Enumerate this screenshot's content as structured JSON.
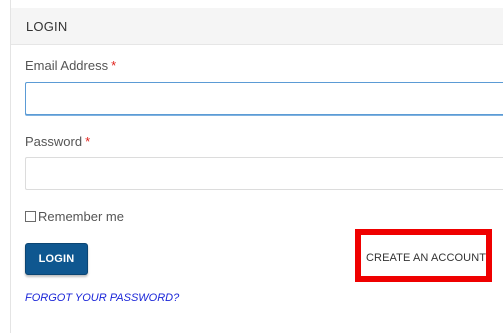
{
  "panel": {
    "title": "LOGIN"
  },
  "form": {
    "email_label": "Email Address",
    "email_required": "*",
    "email_value": "",
    "password_label": "Password",
    "password_required": "*",
    "password_value": "",
    "remember_label": "Remember me",
    "remember_checked": false
  },
  "actions": {
    "login_label": "LOGIN",
    "create_account_label": "CREATE AN ACCOUNT",
    "forgot_password_label": "FORGOT YOUR PASSWORD?"
  },
  "colors": {
    "primary_button": "#0f5790",
    "required_marker": "#e0211b",
    "highlight_box": "#ef0000",
    "forgot_link": "#1a25d8"
  }
}
